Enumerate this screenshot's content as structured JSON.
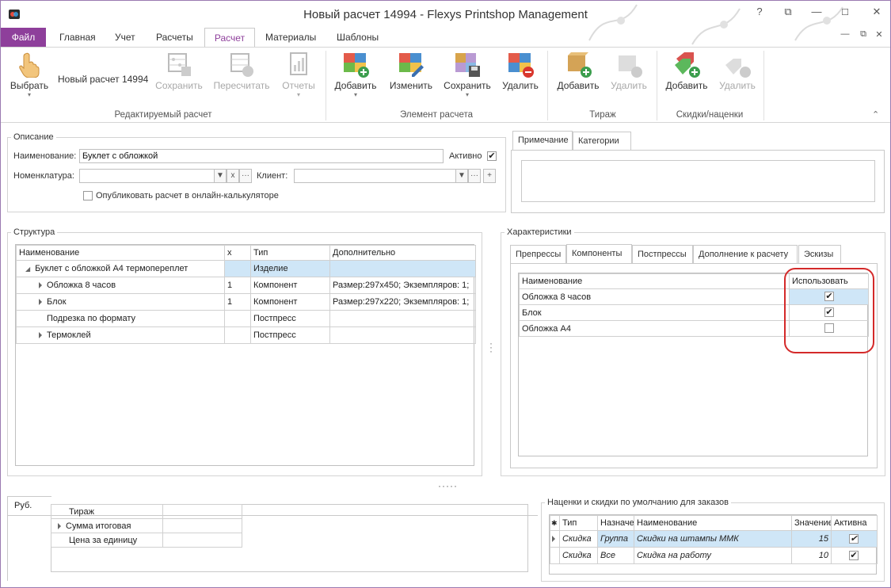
{
  "window": {
    "title": "Новый расчет 14994 - Flexys Printshop Management",
    "controls": {
      "help": "?",
      "restore_top": "⧉",
      "minimize": "—",
      "close": "✕"
    }
  },
  "menu_tabs": [
    "Файл",
    "Главная",
    "Учет",
    "Расчеты",
    "Расчет",
    "Материалы",
    "Шаблоны"
  ],
  "ribbon": {
    "select_label": "Выбрать",
    "calc_name": "Новый расчет 14994",
    "buttons": {
      "save": "Сохранить",
      "recalc": "Пересчитать",
      "reports": "Отчеты",
      "add": "Добавить",
      "edit": "Изменить",
      "save2": "Сохранить",
      "delete": "Удалить",
      "add_run": "Добавить",
      "delete_run": "Удалить",
      "add_disc": "Добавить",
      "delete_disc": "Удалить"
    },
    "groups": {
      "edited": "Редактируемый расчет",
      "element": "Элемент расчета",
      "run": "Тираж",
      "discounts": "Скидки/наценки"
    }
  },
  "description": {
    "legend": "Описание",
    "name_label": "Наименование:",
    "name_value": "Буклет с обложкой",
    "active_label": "Активно",
    "nomenclature_label": "Номенклатура:",
    "client_label": "Клиент:",
    "publish_label": "Опубликовать расчет в онлайн-калькуляторе",
    "clear_btn": "x",
    "more_btn": "···",
    "plus_btn": "+"
  },
  "notes": {
    "tabs": [
      "Примечание",
      "Категории"
    ]
  },
  "structure": {
    "legend": "Структура",
    "columns": [
      "Наименование",
      "x",
      "Тип",
      "Дополнительно"
    ],
    "rows": [
      {
        "name": "Буклет с обложкой А4 термопереплет",
        "x": "",
        "type": "Изделие",
        "extra": ""
      },
      {
        "name": "Обложка 8 часов",
        "x": "1",
        "type": "Компонент",
        "extra": "Размер:297x450; Экземпляров: 1;"
      },
      {
        "name": "Блок",
        "x": "1",
        "type": "Компонент",
        "extra": "Размер:297x220; Экземпляров: 1;"
      },
      {
        "name": "Подрезка по формату",
        "x": "",
        "type": "Постпресс",
        "extra": ""
      },
      {
        "name": "Термоклей",
        "x": "",
        "type": "Постпресс",
        "extra": ""
      }
    ]
  },
  "characteristics": {
    "legend": "Характеристики",
    "tabs": [
      "Препрессы",
      "Компоненты",
      "Постпрессы",
      "Дополнение к расчету",
      "Эскизы"
    ],
    "columns": [
      "Наименование",
      "Использовать"
    ],
    "rows": [
      {
        "name": "Обложка 8 часов",
        "use": "✔"
      },
      {
        "name": "Блок",
        "use": "✔"
      },
      {
        "name": "Обложка А4",
        "use": ""
      }
    ]
  },
  "totals": {
    "tab": "Руб.",
    "rows": [
      "Тираж",
      "Сумма итоговая",
      "Цена за единицу"
    ]
  },
  "markups": {
    "legend": "Наценки и скидки по умолчанию для заказов",
    "columns": [
      "Тип",
      "Назначе",
      "Наименование",
      "Значение",
      "Активна"
    ],
    "rows": [
      {
        "type": "Скидка",
        "assign": "Группа",
        "name": "Скидки на штампы ММК",
        "value": "15",
        "active": "✔"
      },
      {
        "type": "Скидка",
        "assign": "Все",
        "name": "Скидка на работу",
        "value": "10",
        "active": "✔"
      }
    ]
  }
}
